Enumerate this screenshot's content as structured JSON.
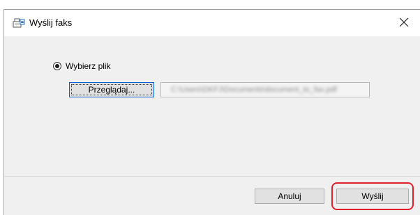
{
  "window": {
    "title": "Wyślij faks",
    "app_icon": "fax-printer-icon",
    "close_icon": "close-icon",
    "close_glyph": "✕"
  },
  "source": {
    "radio_label": "Wybierz plik",
    "radio_selected": true,
    "browse_label": "Przeglądaj...",
    "file_path": "C:\\Users\\DKFJ\\Documents\\document_to_fax.pdf"
  },
  "footer": {
    "cancel_label": "Anuluj",
    "send_label": "Wyślij",
    "highlight_color": "#e0202a"
  }
}
